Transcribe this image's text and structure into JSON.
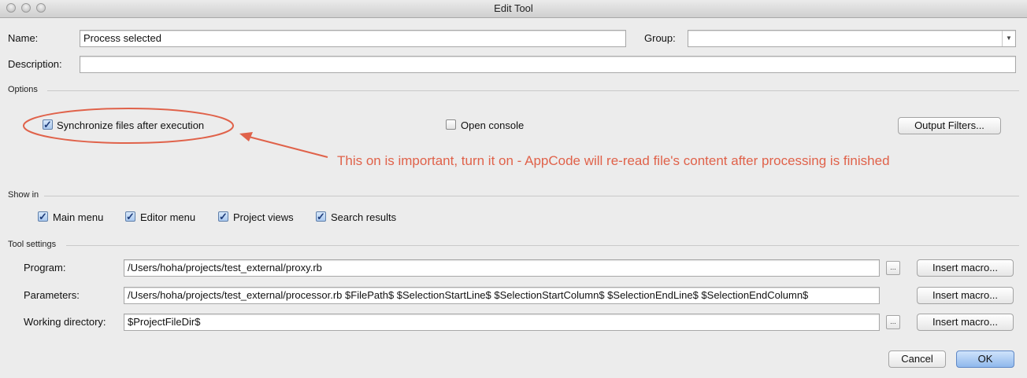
{
  "window": {
    "title": "Edit Tool"
  },
  "name_row": {
    "label": "Name:",
    "value": "Process selected",
    "group_label": "Group:",
    "group_value": ""
  },
  "description_row": {
    "label": "Description:",
    "value": ""
  },
  "options": {
    "header": "Options",
    "sync_label": "Synchronize files after execution",
    "sync_checked": true,
    "console_label": "Open console",
    "console_checked": false,
    "output_filters_label": "Output Filters..."
  },
  "annotation": {
    "text": "This on is important, turn it on - AppCode will re-read file's content after processing is finished",
    "color": "#e0624a"
  },
  "show_in": {
    "header": "Show in",
    "items": [
      {
        "label": "Main menu",
        "checked": true
      },
      {
        "label": "Editor menu",
        "checked": true
      },
      {
        "label": "Project views",
        "checked": true
      },
      {
        "label": "Search results",
        "checked": true
      }
    ]
  },
  "tool_settings": {
    "header": "Tool settings",
    "program_label": "Program:",
    "program_value": "/Users/hoha/projects/test_external/proxy.rb",
    "parameters_label": "Parameters:",
    "parameters_value": "/Users/hoha/projects/test_external/processor.rb $FilePath$ $SelectionStartLine$ $SelectionStartColumn$ $SelectionEndLine$ $SelectionEndColumn$",
    "workdir_label": "Working directory:",
    "workdir_value": "$ProjectFileDir$",
    "browse_label": "...",
    "insert_macro_label": "Insert macro..."
  },
  "footer": {
    "cancel_label": "Cancel",
    "ok_label": "OK"
  }
}
